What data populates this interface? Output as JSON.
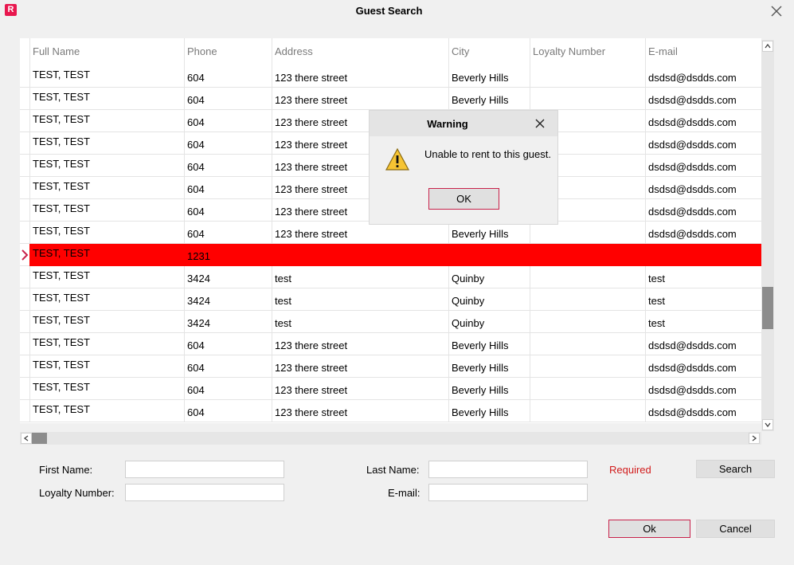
{
  "window": {
    "app_icon_letter": "R",
    "title": "Guest Search"
  },
  "grid": {
    "columns": [
      "Full Name",
      "Phone",
      "Address",
      "City",
      "Loyalty Number",
      "E-mail"
    ],
    "rows": [
      {
        "name": "TEST, TEST",
        "phone": "604",
        "address": "123 there street",
        "city": "Beverly Hills",
        "loyalty": "",
        "email": "dsdsd@dsdds.com"
      },
      {
        "name": "TEST, TEST",
        "phone": "604",
        "address": "123 there street",
        "city": "Beverly Hills",
        "loyalty": "",
        "email": "dsdsd@dsdds.com"
      },
      {
        "name": "TEST, TEST",
        "phone": "604",
        "address": "123 there street",
        "city": "",
        "loyalty": "",
        "email": "dsdsd@dsdds.com"
      },
      {
        "name": "TEST, TEST",
        "phone": "604",
        "address": "123 there street",
        "city": "",
        "loyalty": "",
        "email": "dsdsd@dsdds.com"
      },
      {
        "name": "TEST, TEST",
        "phone": "604",
        "address": "123 there street",
        "city": "",
        "loyalty": "",
        "email": "dsdsd@dsdds.com"
      },
      {
        "name": "TEST, TEST",
        "phone": "604",
        "address": "123 there street",
        "city": "",
        "loyalty": "",
        "email": "dsdsd@dsdds.com"
      },
      {
        "name": "TEST, TEST",
        "phone": "604",
        "address": "123 there street",
        "city": "",
        "loyalty": "",
        "email": "dsdsd@dsdds.com"
      },
      {
        "name": "TEST, TEST",
        "phone": "604",
        "address": "123 there street",
        "city": "Beverly Hills",
        "loyalty": "",
        "email": "dsdsd@dsdds.com"
      },
      {
        "name": "TEST, TEST",
        "phone": "1231",
        "address": "",
        "city": "",
        "loyalty": "",
        "email": "",
        "selected": true
      },
      {
        "name": "TEST, TEST",
        "phone": "3424",
        "address": "test",
        "city": "Quinby",
        "loyalty": "",
        "email": "test"
      },
      {
        "name": "TEST, TEST",
        "phone": "3424",
        "address": "test",
        "city": "Quinby",
        "loyalty": "",
        "email": "test"
      },
      {
        "name": "TEST, TEST",
        "phone": "3424",
        "address": "test",
        "city": "Quinby",
        "loyalty": "",
        "email": "test"
      },
      {
        "name": "TEST, TEST",
        "phone": "604",
        "address": "123 there street",
        "city": "Beverly Hills",
        "loyalty": "",
        "email": "dsdsd@dsdds.com"
      },
      {
        "name": "TEST, TEST",
        "phone": "604",
        "address": "123 there street",
        "city": "Beverly Hills",
        "loyalty": "",
        "email": "dsdsd@dsdds.com"
      },
      {
        "name": "TEST, TEST",
        "phone": "604",
        "address": "123 there street",
        "city": "Beverly Hills",
        "loyalty": "",
        "email": "dsdsd@dsdds.com"
      },
      {
        "name": "TEST, TEST",
        "phone": "604",
        "address": "123 there street",
        "city": "Beverly Hills",
        "loyalty": "",
        "email": "dsdsd@dsdds.com"
      }
    ]
  },
  "form": {
    "first_name_label": "First Name:",
    "first_name_value": "",
    "last_name_label": "Last Name:",
    "last_name_value": "",
    "loyalty_label": "Loyalty Number:",
    "loyalty_value": "",
    "email_label": "E-mail:",
    "email_value": "",
    "required_text": "Required",
    "search_button": "Search",
    "ok_button": "Ok",
    "cancel_button": "Cancel"
  },
  "dialog": {
    "title": "Warning",
    "message": "Unable to rent to this guest.",
    "ok_button": "OK",
    "icon": "warning-icon"
  },
  "colors": {
    "accent": "#e8174e",
    "selected_row": "#ff0000",
    "required": "#d11a1a",
    "ok_border": "#c8224b"
  }
}
